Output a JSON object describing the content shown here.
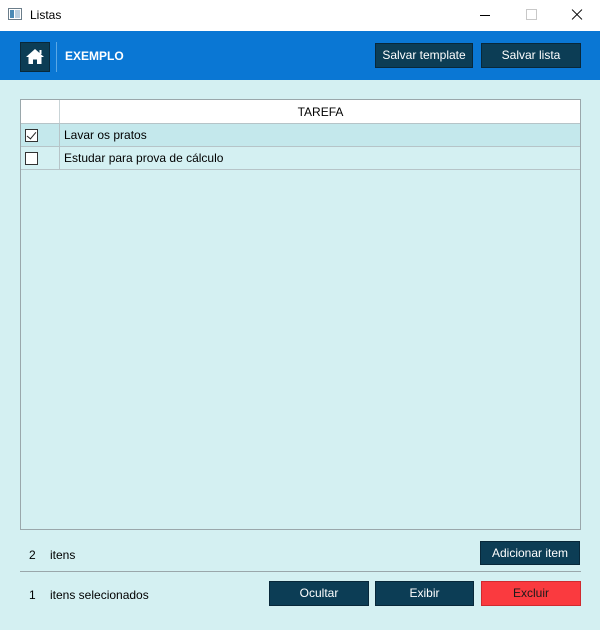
{
  "window": {
    "title": "Listas"
  },
  "header": {
    "list_name": "EXEMPLO",
    "save_template_label": "Salvar template",
    "save_list_label": "Salvar lista"
  },
  "table": {
    "column_header": "TAREFA",
    "rows": [
      {
        "task": "Lavar os pratos",
        "checked": true
      },
      {
        "task": "Estudar para prova de cálculo",
        "checked": false
      }
    ]
  },
  "footer": {
    "item_count": "2",
    "item_count_label": "itens",
    "add_item_label": "Adicionar item",
    "selected_count": "1",
    "selected_label": "itens selecionados",
    "hide_label": "Ocultar",
    "show_label": "Exibir",
    "delete_label": "Excluir"
  },
  "colors": {
    "header_bg": "#0a77d4",
    "button_bg": "#0c3d55",
    "delete_bg": "#fa3a3f",
    "page_bg": "#d4f0f2"
  },
  "icons": {
    "app": "app-window-icon",
    "home": "home-icon"
  }
}
